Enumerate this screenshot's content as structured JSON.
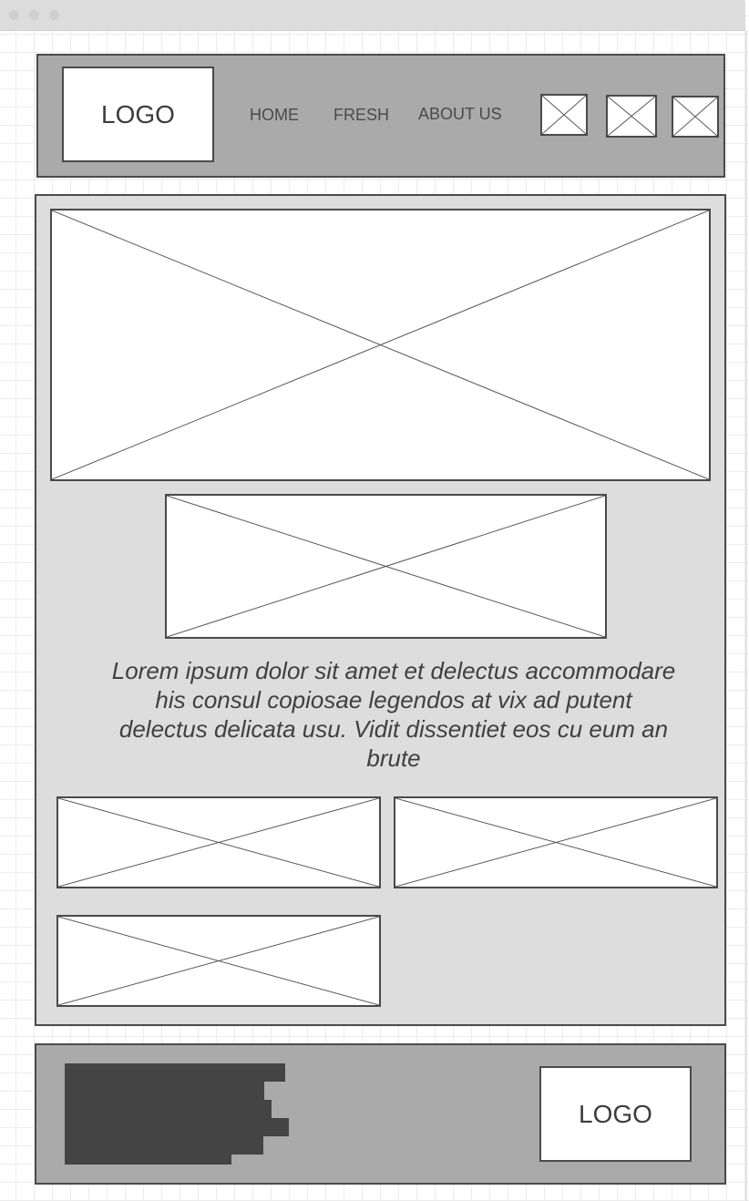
{
  "header": {
    "logo": "LOGO",
    "nav": {
      "home": "HOME",
      "fresh": "FRESH",
      "about": "ABOUT US"
    }
  },
  "main": {
    "paragraph": "Lorem ipsum dolor sit amet et delectus accommodare his consul copiosae legendos at vix ad putent delectus delicata usu. Vidit dissentiet eos cu eum an brute"
  },
  "footer": {
    "logo": "LOGO"
  },
  "icons": {
    "placeholder": "image-placeholder-icon"
  },
  "colors": {
    "header_bg": "#aaaaaa",
    "content_bg": "#dddddd",
    "footer_bg": "#aaaaaa",
    "border": "#4a4a4a",
    "text_block": "#444444"
  }
}
